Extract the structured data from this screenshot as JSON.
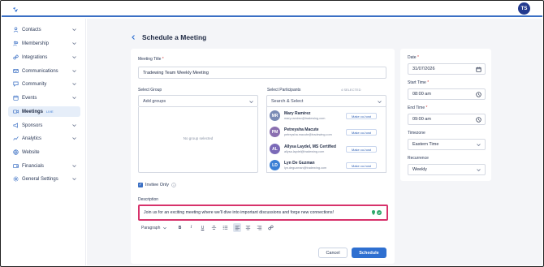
{
  "header": {
    "avatar_initials": "TS"
  },
  "sidebar": {
    "items": [
      {
        "label": "Contacts",
        "icon": "contacts-icon"
      },
      {
        "label": "Membership",
        "icon": "membership-icon"
      },
      {
        "label": "Integrations",
        "icon": "link-icon"
      },
      {
        "label": "Communications",
        "icon": "mail-icon"
      },
      {
        "label": "Community",
        "icon": "community-icon"
      },
      {
        "label": "Events",
        "icon": "calendar-icon"
      },
      {
        "label": "Meetings",
        "icon": "video-icon",
        "badge": "LIVE",
        "active": true
      },
      {
        "label": "Sponsors",
        "icon": "megaphone-icon"
      },
      {
        "label": "Analytics",
        "icon": "analytics-icon"
      },
      {
        "label": "Website",
        "icon": "globe-icon"
      },
      {
        "label": "Financials",
        "icon": "wallet-icon"
      },
      {
        "label": "General Settings",
        "icon": "gear-icon"
      }
    ]
  },
  "page": {
    "title": "Schedule a Meeting"
  },
  "form": {
    "meeting_title_label": "Meeting Title",
    "meeting_title_value": "Tradewing Team Weekly Meeting",
    "select_group_label": "Select Group",
    "select_group_placeholder": "Add groups",
    "no_group_text": "No group selected",
    "select_participants_label": "Select Participants",
    "selected_count": "4 SELECTED",
    "participants_placeholder": "Search & Select",
    "participants": [
      {
        "initials": "MR",
        "name": "Mary Ramirez",
        "email": "mary.ramirez@tradewing.com",
        "action": "Make co-host",
        "color": "#7a8bb5"
      },
      {
        "initials": "PM",
        "name": "Petreysha Macute",
        "email": "petreysha.macute@tradewing.com",
        "action": "Make co-host",
        "color": "#8a6fb0"
      },
      {
        "initials": "AL",
        "name": "Allysa Laydel, MS Certified",
        "email": "allysa.laydel@tradewing.com",
        "action": "Make co-host",
        "color": "#7b6ab8"
      },
      {
        "initials": "LD",
        "name": "Lyn De Guzman",
        "email": "lyn.deguzman@tradewing.com",
        "action": "Make co-host",
        "color": "#3a7fd5"
      }
    ],
    "invitee_only_label": "Invitee Only",
    "invitee_only_checked": true,
    "description_label": "Description",
    "description_value": "Join us for an exciting meeting where we'll dive into important discussions and forge new connections!",
    "editor_paragraph": "Paragraph",
    "cancel_label": "Cancel",
    "schedule_label": "Schedule"
  },
  "side": {
    "date_label": "Date",
    "date_value": "31/07/2026",
    "start_time_label": "Start Time",
    "start_time_value": "08:00 am",
    "end_time_label": "End Time",
    "end_time_value": "09:00 am",
    "timezone_label": "Timezone",
    "timezone_value": "Eastern Time",
    "recurrence_label": "Recurrence",
    "recurrence_value": "Weekly"
  },
  "colors": {
    "accent": "#2e6fd0",
    "highlight": "#d7326b",
    "sidebar_active": "#e6eef9"
  }
}
